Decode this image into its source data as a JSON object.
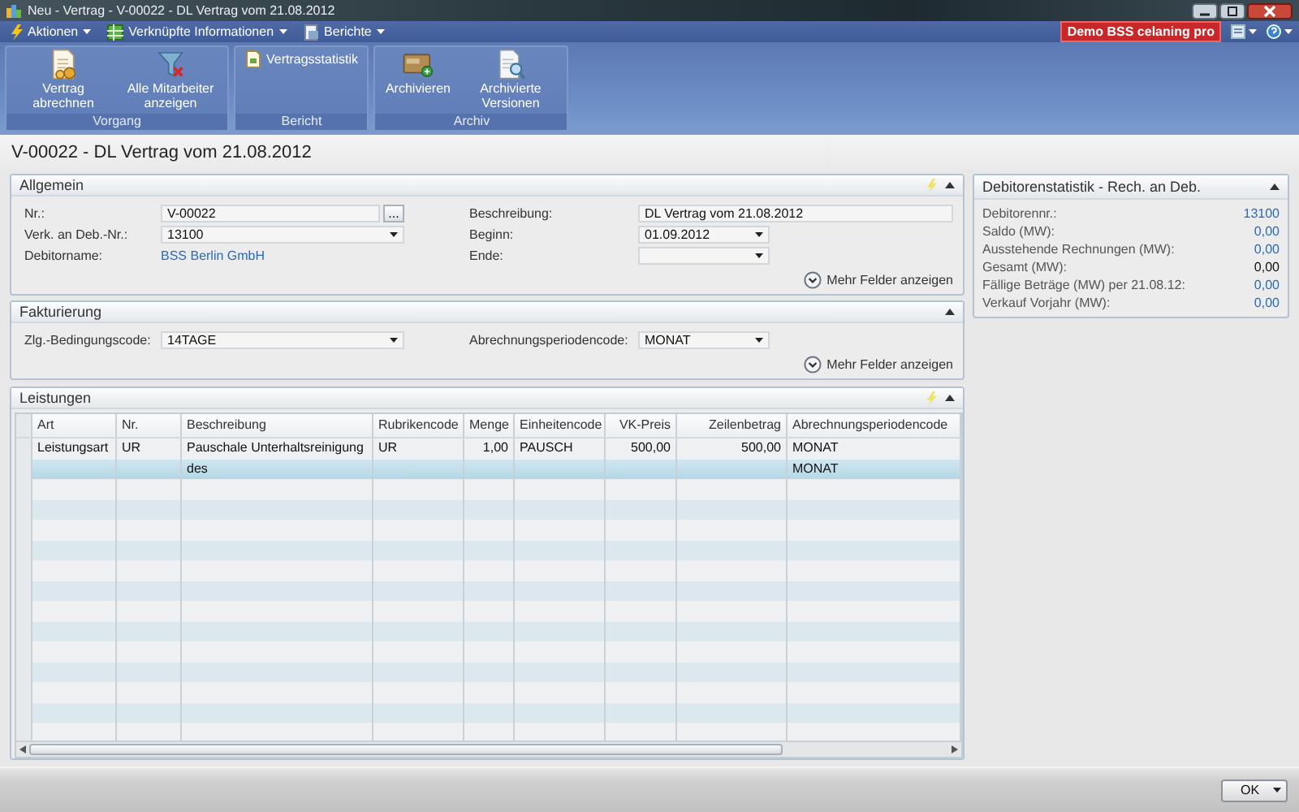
{
  "window": {
    "title": "Neu - Vertrag - V-00022 - DL Vertrag vom 21.08.2012"
  },
  "menu": [
    {
      "label": "Aktionen"
    },
    {
      "label": "Verknüpfte Informationen"
    },
    {
      "label": "Berichte"
    }
  ],
  "badge": "Demo BSS celaning pro",
  "ribbon": [
    {
      "label": "Vorgang",
      "buttons": [
        {
          "label": "Vertrag abrechnen",
          "kind": "large"
        },
        {
          "label": "Alle Mitarbeiter anzeigen",
          "kind": "large"
        }
      ]
    },
    {
      "label": "Bericht",
      "buttons": [
        {
          "label": "Vertragsstatistik",
          "kind": "small"
        }
      ]
    },
    {
      "label": "Archiv",
      "buttons": [
        {
          "label": "Archivieren",
          "kind": "large"
        },
        {
          "label": "Archivierte Versionen",
          "kind": "large"
        }
      ]
    }
  ],
  "page_title": "V-00022 - DL Vertrag vom 21.08.2012",
  "sections": [
    {
      "title": "Allgemein",
      "expanded": true,
      "actions_icon": true,
      "left": [
        {
          "label": "Nr.:",
          "kind": "lookup",
          "value": "V-00022",
          "button": "..."
        },
        {
          "label": "Verk. an Deb.-Nr.:",
          "kind": "dropdown",
          "value": "13100"
        },
        {
          "label": "Debitorname:",
          "kind": "link",
          "value": "BSS Berlin GmbH"
        }
      ],
      "right": [
        {
          "label": "Beschreibung:",
          "kind": "text",
          "value": "DL Vertrag vom 21.08.2012"
        },
        {
          "label": "Beginn:",
          "kind": "dropdown",
          "value": "01.09.2012"
        },
        {
          "label": "Ende:",
          "kind": "dropdown"
        }
      ],
      "more": "Mehr Felder anzeigen"
    },
    {
      "title": "Fakturierung",
      "expanded": true,
      "actions_icon": false,
      "left": [
        {
          "label": "Zlg.-Bedingungscode:",
          "kind": "dropdown",
          "value": "14TAGE"
        }
      ],
      "right": [
        {
          "label": "Abrechnungsperiodencode:",
          "kind": "dropdown",
          "value": "MONAT"
        }
      ],
      "more": "Mehr Felder anzeigen"
    }
  ],
  "lines": {
    "title": "Leistungen",
    "expanded": true,
    "actions_icon": true,
    "columns": [
      {
        "label": "Art",
        "kind": "text"
      },
      {
        "label": "Nr.",
        "kind": "text"
      },
      {
        "label": "Beschreibung",
        "kind": "text"
      },
      {
        "label": "Rubrikencode",
        "kind": "text"
      },
      {
        "label": "Menge",
        "kind": "number"
      },
      {
        "label": "Einheitencode",
        "kind": "text"
      },
      {
        "label": "VK-Preis",
        "kind": "number"
      },
      {
        "label": "Zeilenbetrag",
        "kind": "number"
      },
      {
        "label": "Abrechnungsperiodencode",
        "kind": "text"
      }
    ],
    "rows": [
      {
        "selected": false,
        "cells": [
          "Leistungsart",
          "UR",
          "Pauschale Unterhaltsreinigung",
          "UR",
          "1,00",
          "PAUSCH",
          "500,00",
          "500,00",
          "MONAT"
        ]
      },
      {
        "selected": true,
        "cells": [
          null,
          null,
          "des",
          null,
          null,
          null,
          null,
          null,
          "MONAT"
        ]
      }
    ]
  },
  "stats": {
    "title": "Debitorenstatistik - Rech. an Deb.",
    "expanded": true,
    "rows": [
      {
        "label": "Debitorennr.:",
        "value": "13100",
        "kind": "link"
      },
      {
        "label": "Saldo (MW):",
        "value": "0,00",
        "kind": "link"
      },
      {
        "label": "Ausstehende Rechnungen (MW):",
        "value": "0,00",
        "kind": "link"
      },
      {
        "label": "Gesamt (MW):",
        "value": "0,00",
        "kind": "plain"
      },
      {
        "label": "Fällige Beträge (MW) per 21.08.12:",
        "value": "0,00",
        "kind": "link"
      },
      {
        "label": "Verkauf Vorjahr (MW):",
        "value": "0,00",
        "kind": "link"
      }
    ]
  },
  "footer": {
    "ok": "OK"
  }
}
